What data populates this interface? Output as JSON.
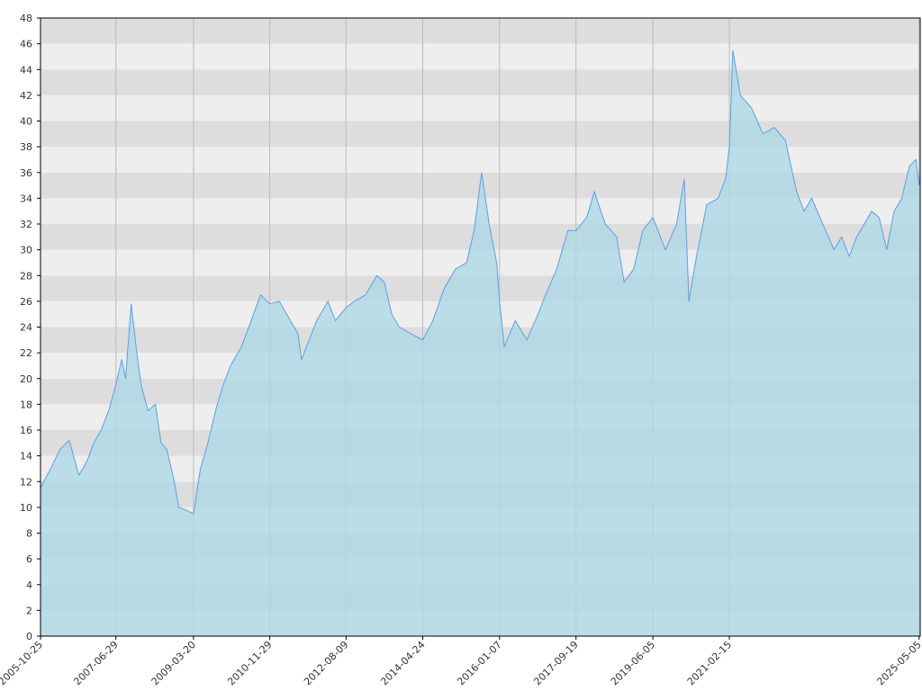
{
  "chart_data": {
    "type": "area",
    "title": "",
    "xlabel": "",
    "ylabel": "",
    "x_tick_labels": [
      "2005-10-25",
      "2007-06-29",
      "2009-03-20",
      "2010-11-29",
      "2012-08-09",
      "2014-04-24",
      "2016-01-07",
      "2017-09-19",
      "2019-06-05",
      "2021-02-15",
      "2025-05-05"
    ],
    "y_ticks": [
      0,
      2,
      4,
      6,
      8,
      10,
      12,
      14,
      16,
      18,
      20,
      22,
      24,
      26,
      28,
      30,
      32,
      34,
      36,
      38,
      40,
      42,
      44,
      46,
      48
    ],
    "ylim": [
      0,
      48
    ],
    "xlim": [
      "2005-10-25",
      "2025-05-14"
    ],
    "grid": "horizontal alternating bands, vertical lines at x ticks",
    "colors": {
      "line": "#5aa0e6",
      "fill": "#add8e6",
      "band_dark": "#dddddd",
      "band_light": "#eeeeee",
      "grid_line": "#bbbbbb",
      "axis": "#000000"
    },
    "series": [
      {
        "x": [
          "2005-10-25",
          "2006-01-15",
          "2006-04-01",
          "2006-06-15",
          "2006-09-01",
          "2006-10-15",
          "2006-11-15",
          "2007-01-01",
          "2007-03-01",
          "2007-05-01",
          "2007-06-29",
          "2007-08-15",
          "2007-09-15",
          "2007-10-31",
          "2007-12-15",
          "2008-01-20",
          "2008-03-15",
          "2008-05-15",
          "2008-06-30",
          "2008-08-15",
          "2008-10-15",
          "2008-11-20",
          "2009-01-15",
          "2009-03-20",
          "2009-05-15",
          "2009-07-15",
          "2009-09-15",
          "2009-11-15",
          "2010-01-15",
          "2010-04-15",
          "2010-07-01",
          "2010-09-15",
          "2010-11-29",
          "2011-02-15",
          "2011-04-15",
          "2011-07-15",
          "2011-08-15",
          "2011-10-15",
          "2011-12-15",
          "2012-03-15",
          "2012-05-15",
          "2012-08-09",
          "2012-10-15",
          "2013-01-15",
          "2013-04-15",
          "2013-06-15",
          "2013-08-15",
          "2013-10-15",
          "2014-01-15",
          "2014-04-24",
          "2014-07-15",
          "2014-10-15",
          "2015-01-15",
          "2015-04-15",
          "2015-06-15",
          "2015-08-15",
          "2015-10-15",
          "2015-12-15",
          "2016-01-07",
          "2016-02-15",
          "2016-05-15",
          "2016-08-15",
          "2016-11-15",
          "2017-01-15",
          "2017-04-15",
          "2017-07-15",
          "2017-09-19",
          "2017-12-15",
          "2018-02-15",
          "2018-05-15",
          "2018-08-15",
          "2018-10-15",
          "2018-12-31",
          "2019-03-15",
          "2019-06-05",
          "2019-09-15",
          "2019-12-15",
          "2020-02-15",
          "2020-03-23",
          "2020-05-15",
          "2020-08-15",
          "2020-11-15",
          "2021-01-15",
          "2021-02-15",
          "2021-03-15",
          "2021-05-15",
          "2021-08-15",
          "2021-11-15",
          "2022-02-15",
          "2022-05-15",
          "2022-08-15",
          "2022-10-15",
          "2022-12-15",
          "2023-03-15",
          "2023-06-15",
          "2023-08-15",
          "2023-10-15",
          "2023-12-15",
          "2024-02-15",
          "2024-04-15",
          "2024-06-15",
          "2024-08-15",
          "2024-10-15",
          "2024-12-15",
          "2025-02-15",
          "2025-04-10",
          "2025-05-05",
          "2025-05-14"
        ],
        "values": [
          11.5,
          13.0,
          14.5,
          15.2,
          12.5,
          13.2,
          13.8,
          15.0,
          16.0,
          17.5,
          19.5,
          21.5,
          20.0,
          25.8,
          22.0,
          19.5,
          17.5,
          18.0,
          15.0,
          14.5,
          12.0,
          10.0,
          9.8,
          9.5,
          13.0,
          15.0,
          17.5,
          19.5,
          21.0,
          22.5,
          24.5,
          26.5,
          25.8,
          26.0,
          25.0,
          23.5,
          21.5,
          23.0,
          24.5,
          26.0,
          24.5,
          25.5,
          26.0,
          26.5,
          28.0,
          27.5,
          25.0,
          24.0,
          23.5,
          23.0,
          24.5,
          27.0,
          28.5,
          29.0,
          31.5,
          36.0,
          32.0,
          29.0,
          26.0,
          22.5,
          24.5,
          23.0,
          25.0,
          26.5,
          28.5,
          31.5,
          31.5,
          32.5,
          34.5,
          32.0,
          31.0,
          27.5,
          28.5,
          31.5,
          32.5,
          30.0,
          32.0,
          35.5,
          26.0,
          29.0,
          33.5,
          34.0,
          35.5,
          38.0,
          45.5,
          42.0,
          41.0,
          39.0,
          39.5,
          38.5,
          34.5,
          33.0,
          34.0,
          32.0,
          30.0,
          31.0,
          29.5,
          31.0,
          32.0,
          33.0,
          32.5,
          30.0,
          33.0,
          34.0,
          36.5,
          37.0,
          35.0,
          36.0
        ]
      }
    ]
  }
}
